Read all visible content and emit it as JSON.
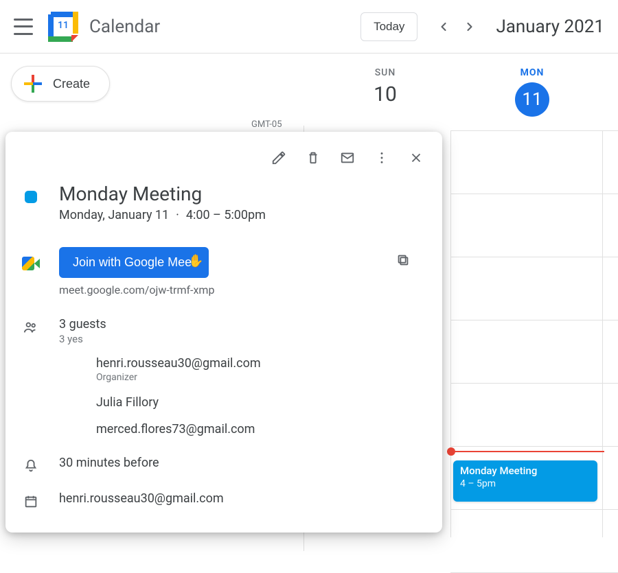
{
  "header": {
    "app_name": "Calendar",
    "logo_day": "11",
    "today_label": "Today",
    "month_title": "January 2021"
  },
  "create_label": "Create",
  "timezone_label": "GMT-05",
  "days": {
    "sun": {
      "dow": "SUN",
      "dom": "10"
    },
    "mon": {
      "dow": "MON",
      "dom": "11"
    }
  },
  "event_chip": {
    "title": "Monday Meeting",
    "time": "4 – 5pm"
  },
  "popover": {
    "title": "Monday Meeting",
    "date": "Monday, January 11",
    "time": "4:00 – 5:00pm",
    "join_label": "Join with Google Meet",
    "meet_url": "meet.google.com/ojw-trmf-xmp",
    "guests_count": "3 guests",
    "guests_status": "3 yes",
    "guests": [
      {
        "email": "henri.rousseau30@gmail.com",
        "role": "Organizer"
      },
      {
        "email": "Julia Fillory",
        "role": ""
      },
      {
        "email": "merced.flores73@gmail.com",
        "role": ""
      }
    ],
    "reminder": "30 minutes before",
    "owner": "henri.rousseau30@gmail.com"
  },
  "colors": {
    "event": "#039be5",
    "primary": "#1a73e8"
  }
}
